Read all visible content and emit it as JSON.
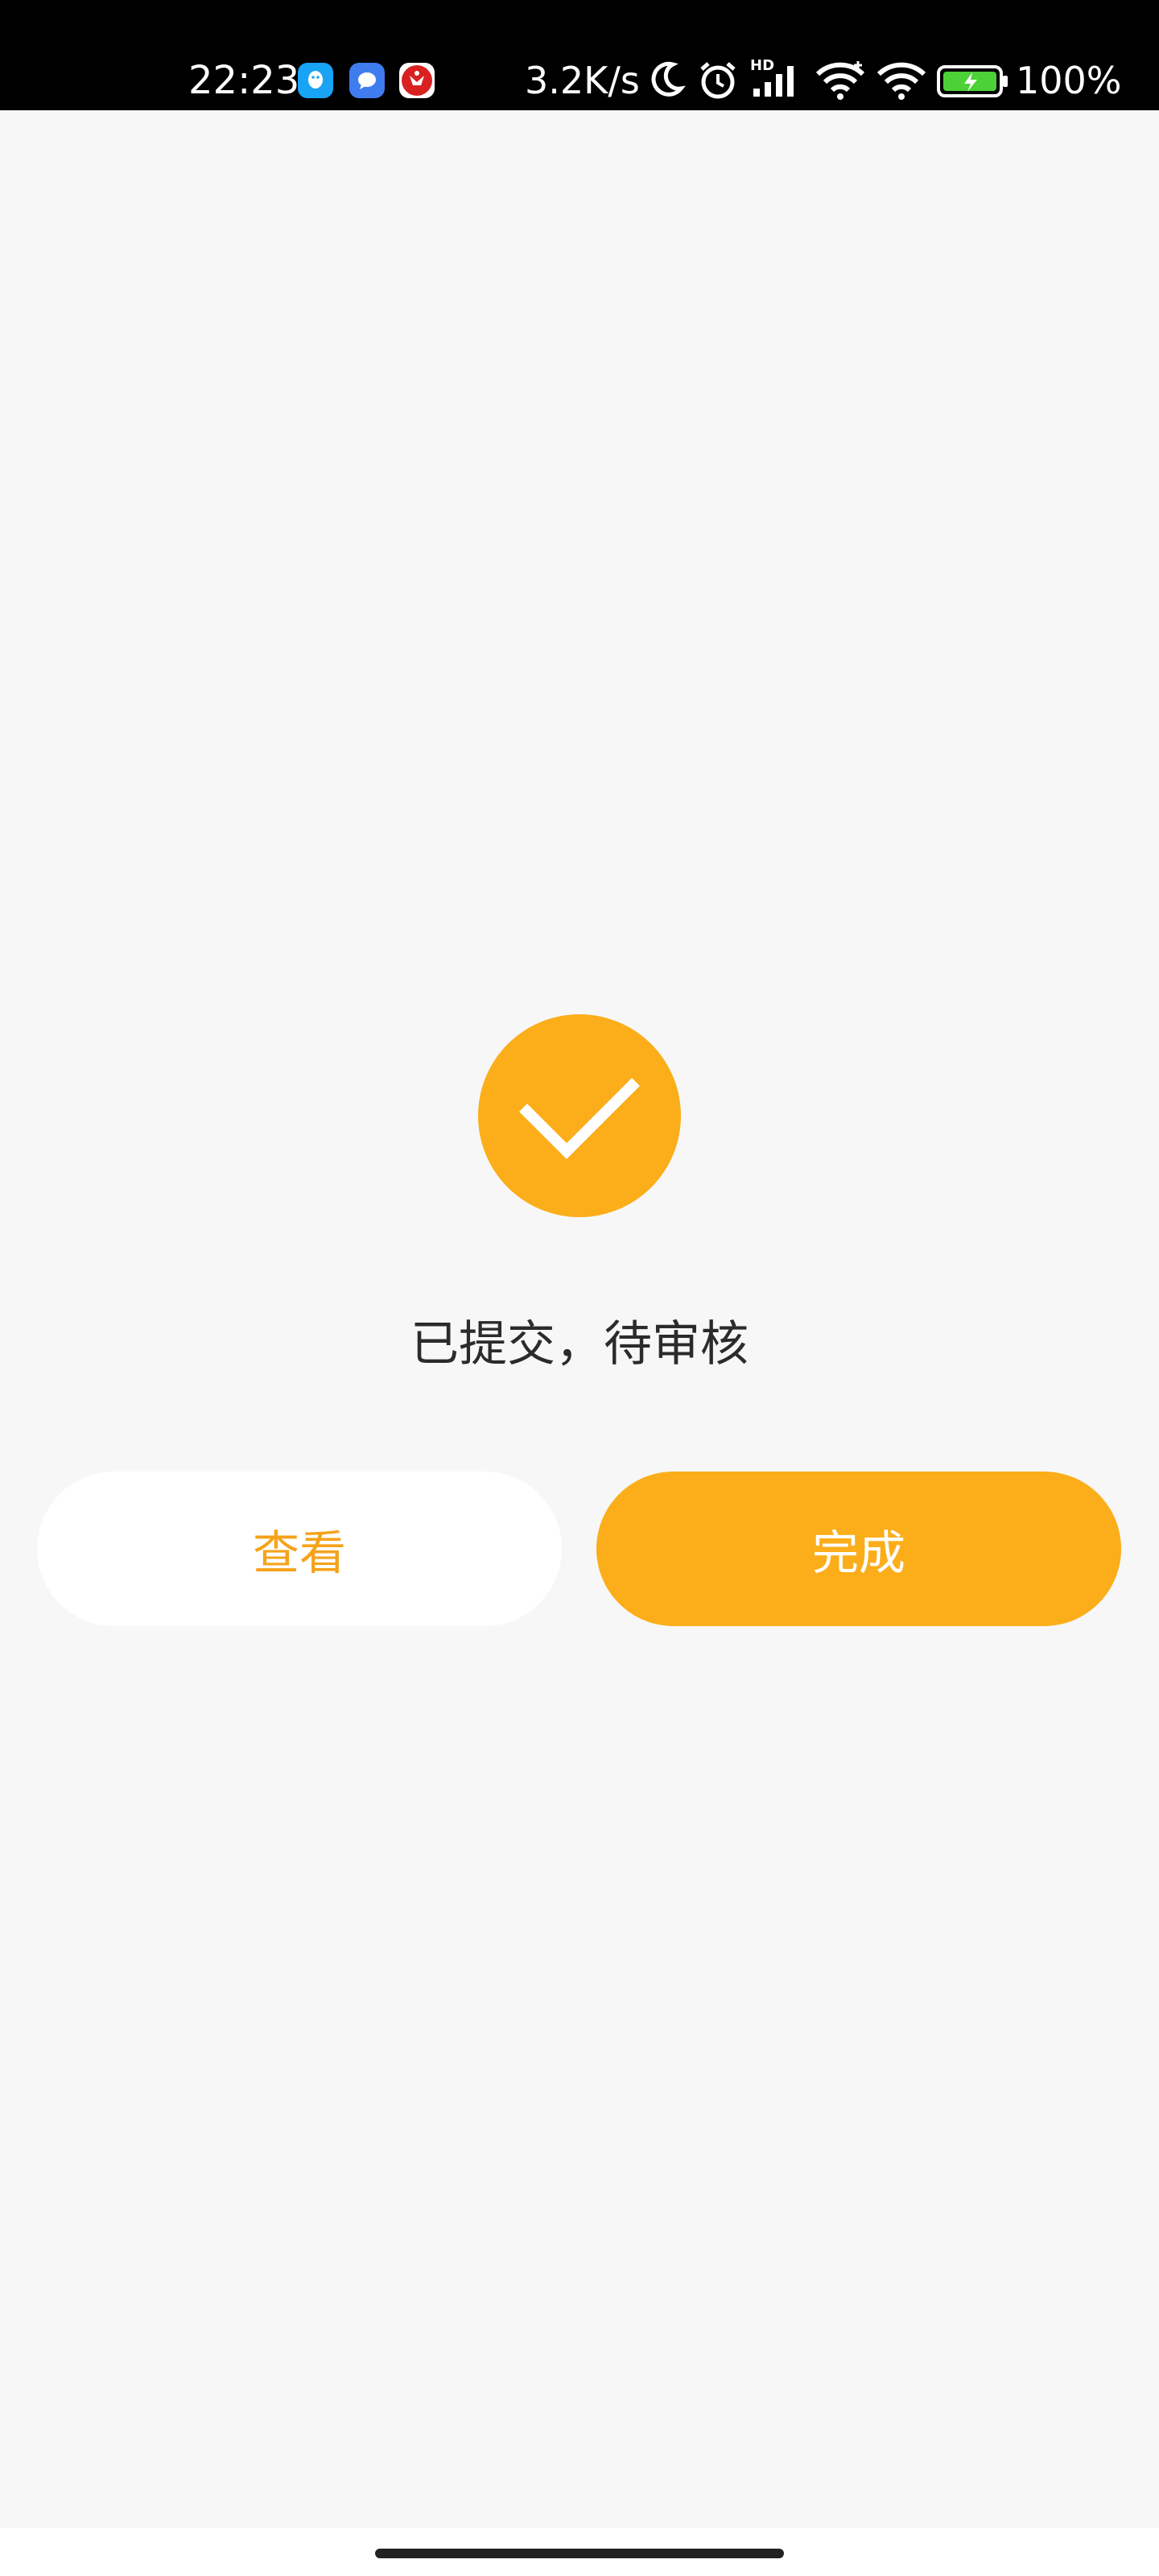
{
  "status_bar": {
    "time": "22:23",
    "network_speed": "3.2K/s",
    "battery_percent": "100%",
    "signal_label": "HD",
    "apps": [
      "qq-icon",
      "message-icon",
      "red-app-icon"
    ],
    "icons": [
      "moon-icon",
      "alarm-icon",
      "signal-icon",
      "wifi-icon",
      "wifi-icon",
      "battery-icon"
    ]
  },
  "result": {
    "icon": "check-icon",
    "message": "已提交，待审核"
  },
  "actions": {
    "view_label": "查看",
    "done_label": "完成"
  },
  "colors": {
    "accent": "#fbae1a",
    "accent_text": "#f5a31a",
    "background": "#f7f7f7",
    "status_bar": "#000000",
    "battery_charge": "#4cd137"
  }
}
